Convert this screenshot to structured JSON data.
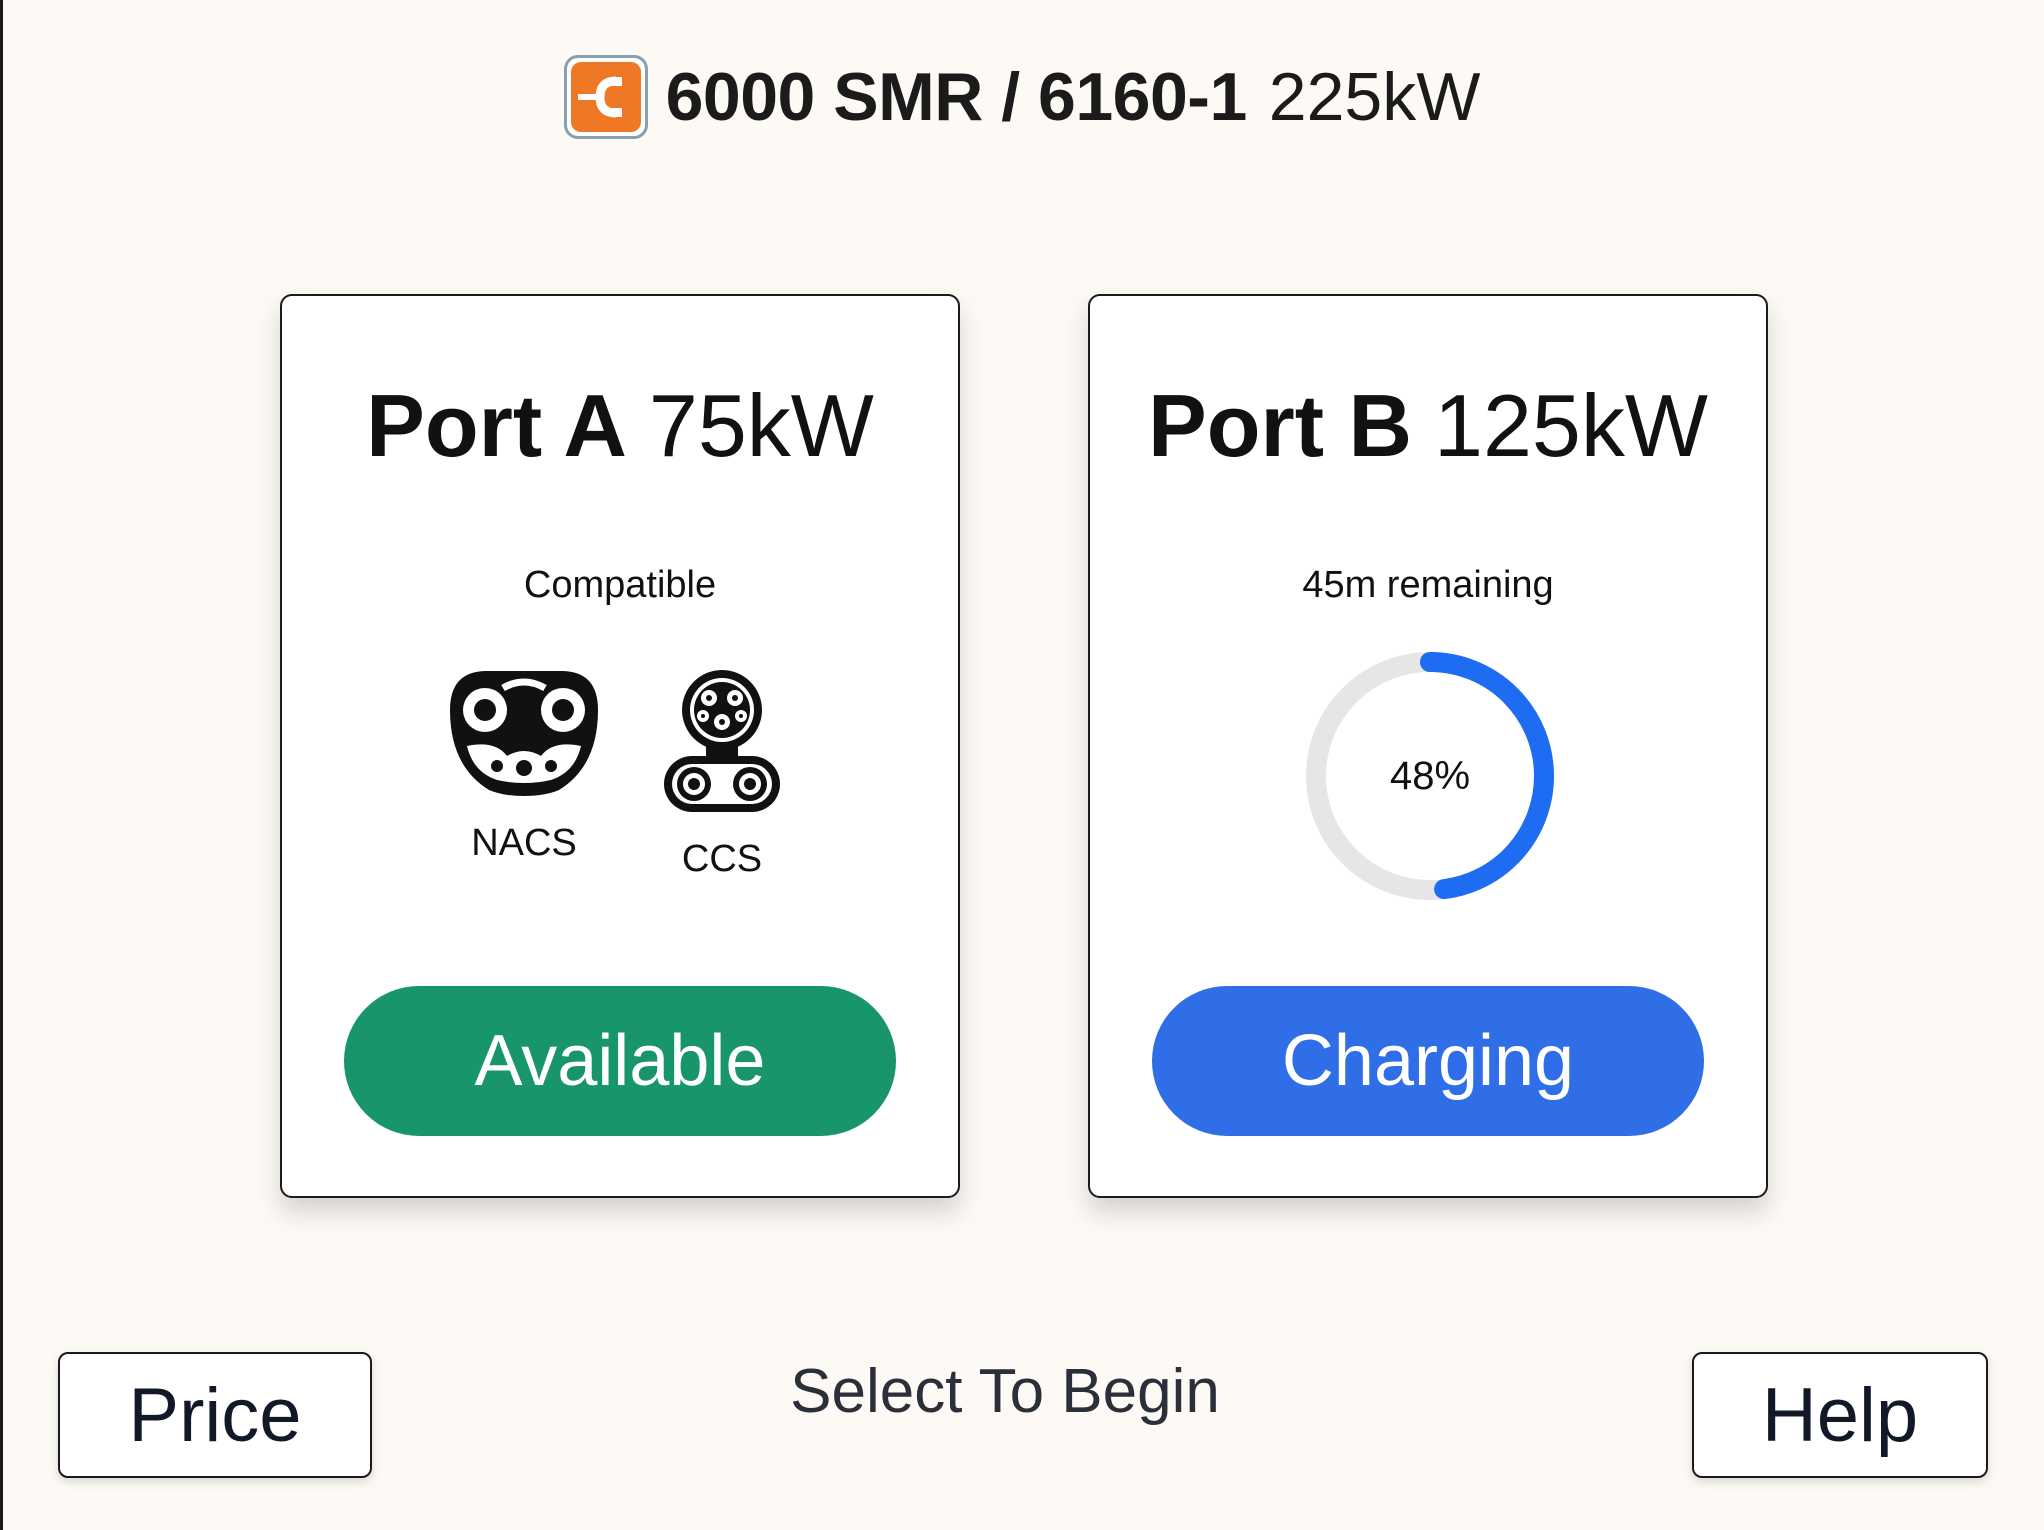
{
  "header": {
    "logo_icon": "charger-brand-logo-icon",
    "station_id": "6000 SMR / 6160-1",
    "station_power": "225kW"
  },
  "ports": [
    {
      "name": "Port A",
      "power": "75kW",
      "subtitle": "Compatible",
      "connectors": [
        {
          "label": "NACS",
          "icon": "nacs-connector-icon"
        },
        {
          "label": "CCS",
          "icon": "ccs-connector-icon"
        }
      ],
      "status": "Available",
      "status_color": "#19956a"
    },
    {
      "name": "Port B",
      "power": "125kW",
      "subtitle": "45m remaining",
      "progress_percent": 48,
      "progress_label": "48%",
      "status": "Charging",
      "status_color": "#2f6ee6"
    }
  ],
  "footer": {
    "price_label": "Price",
    "prompt": "Select To Begin",
    "help_label": "Help"
  },
  "colors": {
    "background": "#fdfaf5",
    "logo_accent": "#ef7826",
    "progress_fill": "#1d6cf2",
    "progress_track": "#e6e6e6"
  }
}
